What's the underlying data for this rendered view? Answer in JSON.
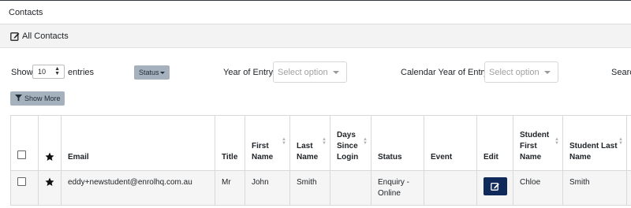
{
  "header": {
    "title": "Contacts"
  },
  "card": {
    "title": "All Contacts"
  },
  "filters": {
    "show_label": "Show",
    "page_length": "10",
    "entries_label": "entries",
    "status_button": "Status",
    "year_of_entry_label": "Year of Entry:",
    "year_of_entry_placeholder": "Select option",
    "calendar_year_label": "Calendar Year of Entry:",
    "calendar_year_placeholder": "Select option",
    "search_label": "Search:",
    "show_more_button": "Show More"
  },
  "table": {
    "columns": {
      "email": "Email",
      "title": "Title",
      "first_name": "First Name",
      "last_name": "Last Name",
      "days_since_login": "Days Since Login",
      "status": "Status",
      "event": "Event",
      "edit": "Edit",
      "student_first_name": "Student First Name",
      "student_last_name": "Student Last Name"
    },
    "rows": [
      {
        "email": "eddy+newstudent@enrolhq.com.au",
        "title": "Mr",
        "first_name": "John",
        "last_name": "Smith",
        "days_since_login": "",
        "status": "Enquiry - Online",
        "event": "",
        "student_first_name": "Chloe",
        "student_last_name": "Smith"
      }
    ]
  },
  "colors": {
    "primary_button": "#0f2a5a",
    "secondary_button": "#a5b2bd"
  }
}
